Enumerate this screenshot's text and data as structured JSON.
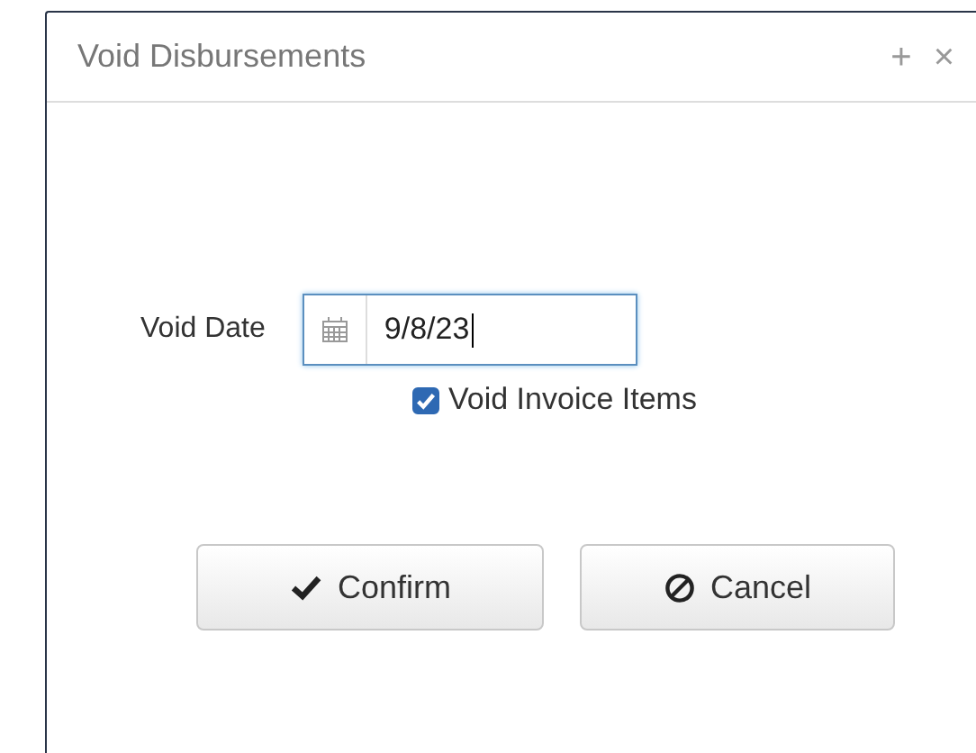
{
  "window": {
    "title": "Void Disbursements",
    "controls": [
      "+",
      "×"
    ]
  },
  "void_date": {
    "label": "Void Date",
    "value": "9/8/23"
  },
  "void_invoice_items": {
    "label": "Void Invoice Items",
    "checked": true
  },
  "buttons": [
    {
      "kind": "confirm",
      "label": "Confirm"
    },
    {
      "kind": "cancel",
      "label": "Cancel"
    }
  ]
}
